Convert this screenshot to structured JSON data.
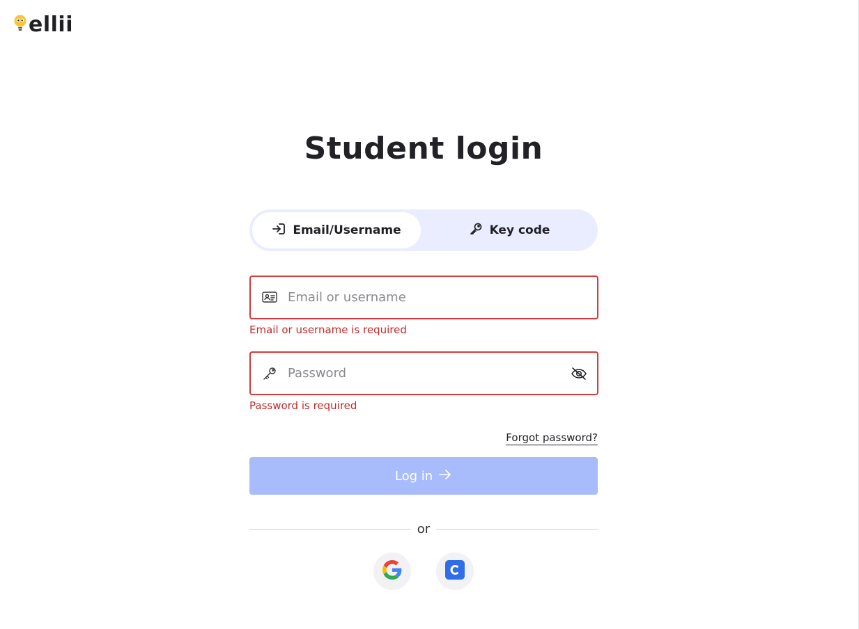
{
  "brand": {
    "name": "ellii"
  },
  "title": "Student login",
  "tabs": [
    {
      "label": "Email/Username",
      "icon": "login-arrow-icon",
      "active": true
    },
    {
      "label": "Key code",
      "icon": "key-icon",
      "active": false
    }
  ],
  "email_field": {
    "placeholder": "Email or username",
    "value": "",
    "icon": "id-card-icon",
    "error": "Email or username is required"
  },
  "password_field": {
    "placeholder": "Password",
    "value": "",
    "icon": "key-icon",
    "toggle_icon": "eye-slash-icon",
    "error": "Password is required"
  },
  "forgot_password": "Forgot password?",
  "login_button": {
    "label": "Log in",
    "icon": "arrow-right-icon"
  },
  "divider_text": "or",
  "social": [
    {
      "provider": "Google",
      "icon": "google-icon"
    },
    {
      "provider": "Clever",
      "icon": "clever-icon"
    }
  ],
  "colors": {
    "error": "#d93838",
    "error_text": "#c62828",
    "button_disabled": "#a8bcfb",
    "tabs_bg": "#e9edff",
    "clever_blue": "#2f6ee8",
    "logo_yellow": "#f6c53b"
  }
}
